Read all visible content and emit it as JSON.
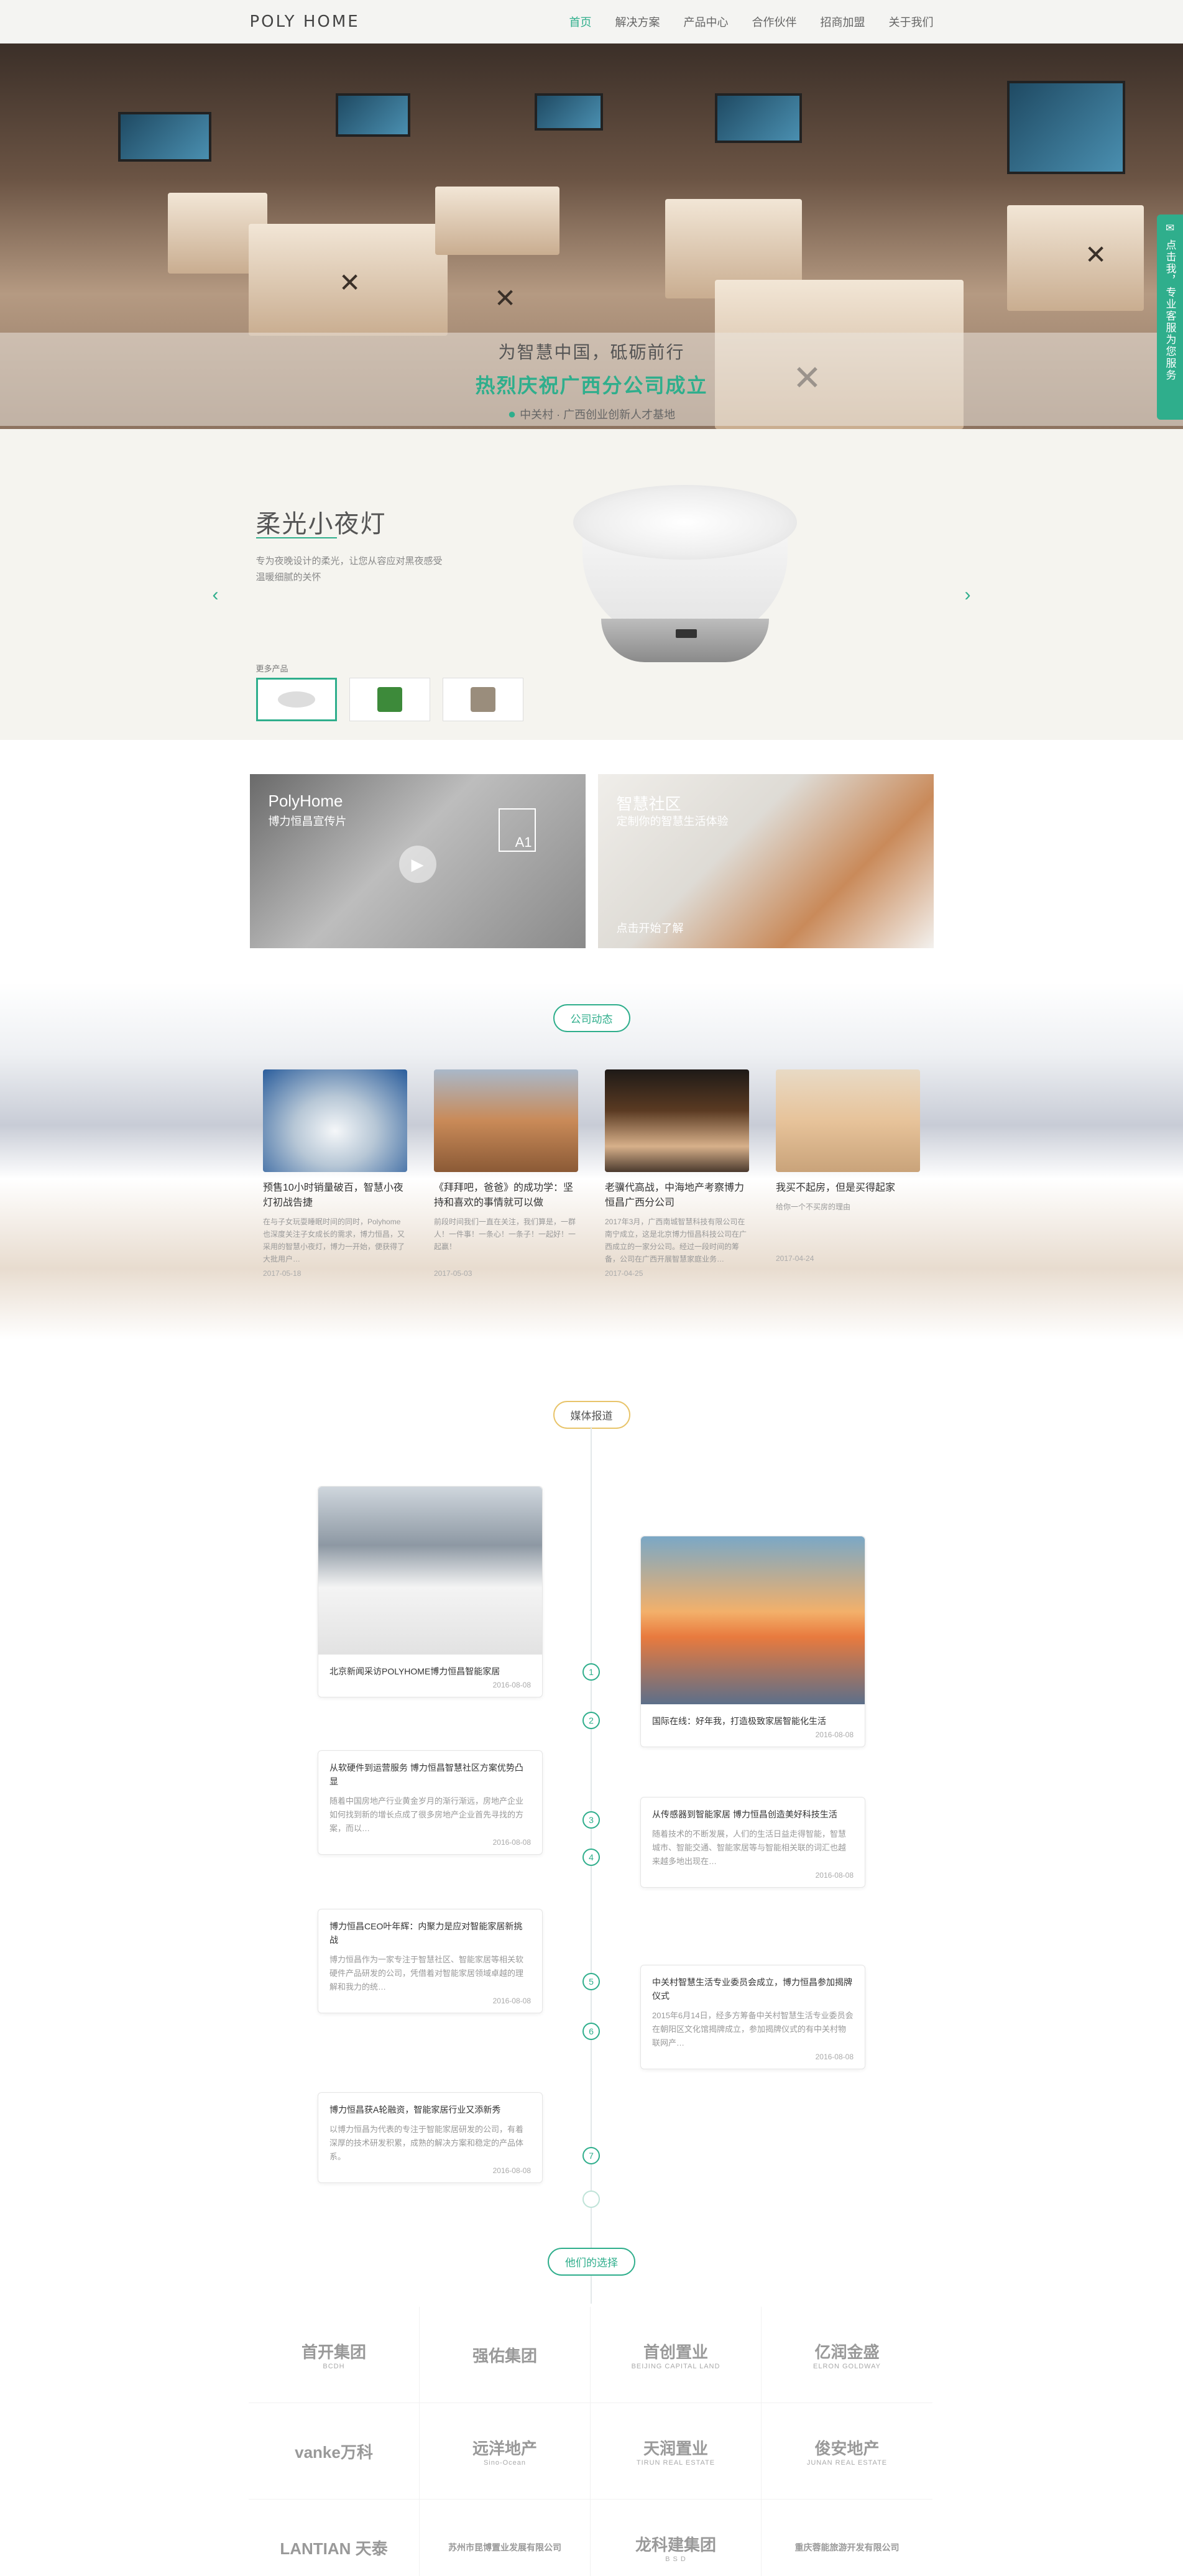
{
  "header": {
    "logo": "POLY HOME",
    "nav": [
      "首页",
      "解决方案",
      "产品中心",
      "合作伙伴",
      "招商加盟",
      "关于我们"
    ],
    "active_index": 0
  },
  "banner": {
    "line1": "为智慧中国，砥砺前行",
    "line2": "热烈庆祝广西分公司成立",
    "location": "中关村 · 广西创业创新人才基地",
    "slides": 4,
    "active_slide": 0
  },
  "side_service": {
    "label": "点击我，专业客服为您服务",
    "icon": "chat-icon"
  },
  "product": {
    "title": "柔光小夜灯",
    "desc": "专为夜晚设计的柔光，让您从容应对黑夜感受温暖细腻的关怀",
    "more_label": "更多产品",
    "prev_icon": "chevron-left-icon",
    "next_icon": "chevron-right-icon"
  },
  "promo": {
    "video": {
      "title": "PolyHome",
      "subtitle": "博力恒昌宣传片",
      "sign": "A1"
    },
    "community": {
      "title": "智慧社区",
      "subtitle": "定制你的智慧生活体验",
      "cta": "点击开始了解"
    }
  },
  "news": {
    "label": "公司动态",
    "items": [
      {
        "title": "预售10小时销量破百，智慧小夜灯初战告捷",
        "summary": "在与子女玩耍睡眠时间的同时，Polyhome也深度关注子女成长的需求，博力恒昌，又采用的智慧小夜灯，博力一开始，便获得了大批用户…",
        "date": "2017-05-18"
      },
      {
        "title": "《拜拜吧，爸爸》的成功学：坚持和喜欢的事情就可以做",
        "summary": "前段时间我们一直在关注，我们算是，一群人！一件事！一条心！一条子！一起好！一起赢！",
        "date": "2017-05-03"
      },
      {
        "title": "老骥代高战，中海地产考察博力恒昌广西分公司",
        "summary": "2017年3月，广西南城智慧科技有限公司在南宁成立，这是北京博力恒昌科技公司在广西成立的一家分公司。经过一段时间的筹备，公司在广西开展智慧家庭业务…",
        "date": "2017-04-25"
      },
      {
        "title": "我买不起房，但是买得起家",
        "summary": "给你一个不买房的理由",
        "date": "2017-04-24"
      }
    ]
  },
  "media": {
    "label": "媒体报道",
    "timeline": [
      "1",
      "2",
      "3",
      "4",
      "5",
      "6",
      "7",
      ""
    ],
    "cards": [
      {
        "title": "北京新闻采访POLYHOME博力恒昌智能家居",
        "summary": "",
        "date": "2016-08-08"
      },
      {
        "title": "国际在线：好年我，打造极致家居智能化生活",
        "summary": "",
        "date": "2016-08-08"
      },
      {
        "title": "从软硬件到运营服务 博力恒昌智慧社区方案优势凸显",
        "summary": "随着中国房地产行业黄金岁月的渐行渐远，房地产企业如何找到新的增长点成了很多房地产企业首先寻找的方案，而以…",
        "date": "2016-08-08"
      },
      {
        "title": "从传感器到智能家居 博力恒昌创造美好科技生活",
        "summary": "随着技术的不断发展，人们的生活日益走得智能，智慧城市、智能交通、智能家居等与智能相关联的词汇也越来越多地出现在…",
        "date": "2016-08-08"
      },
      {
        "title": "博力恒昌CEO叶年辉：内聚力是应对智能家居新挑战",
        "summary": "博力恒昌作为一家专注于智慧社区、智能家居等相关软硬件产品研发的公司，凭借着对智能家居领域卓越的理解和我力的统…",
        "date": "2016-08-08"
      },
      {
        "title": "中关村智慧生活专业委员会成立，博力恒昌参加揭牌仪式",
        "summary": "2015年6月14日，经多方筹备中关村智慧生活专业委员会在朝阳区文化馆揭牌成立，参加揭牌仪式的有中关村物联网产…",
        "date": "2016-08-08"
      },
      {
        "title": "博力恒昌获A轮融资，智能家居行业又添新秀",
        "summary": "以博力恒昌为代表的专注于智能家居研发的公司，有着深厚的技术研发积累，成熟的解决方案和稳定的产品体系。",
        "date": "2016-08-08"
      }
    ]
  },
  "partners": {
    "label": "他们的选择",
    "logos": [
      {
        "name": "首开集团",
        "sub": "BCDH"
      },
      {
        "name": "强佑集团",
        "sub": ""
      },
      {
        "name": "首创置业",
        "sub": "BEIJING CAPITAL LAND"
      },
      {
        "name": "亿润金盛",
        "sub": "ELRON GOLDWAY"
      },
      {
        "name": "vanke万科",
        "sub": ""
      },
      {
        "name": "远洋地产",
        "sub": "Sino-Ocean"
      },
      {
        "name": "天润置业",
        "sub": "TIRUN REAL ESTATE"
      },
      {
        "name": "俊安地产",
        "sub": "JUNAN REAL ESTATE"
      },
      {
        "name": "LANTIAN 天泰",
        "sub": ""
      },
      {
        "name": "苏州市昆博置业发展有限公司",
        "sub": ""
      },
      {
        "name": "龙科建集团",
        "sub": "B S D"
      },
      {
        "name": "重庆蓉能旅游开发有限公司",
        "sub": ""
      }
    ]
  },
  "colors": {
    "accent": "#2fae8c",
    "gold": "#e8c46a",
    "header_bg": "#f4f4f2",
    "product_bg": "#f5f4ef"
  }
}
